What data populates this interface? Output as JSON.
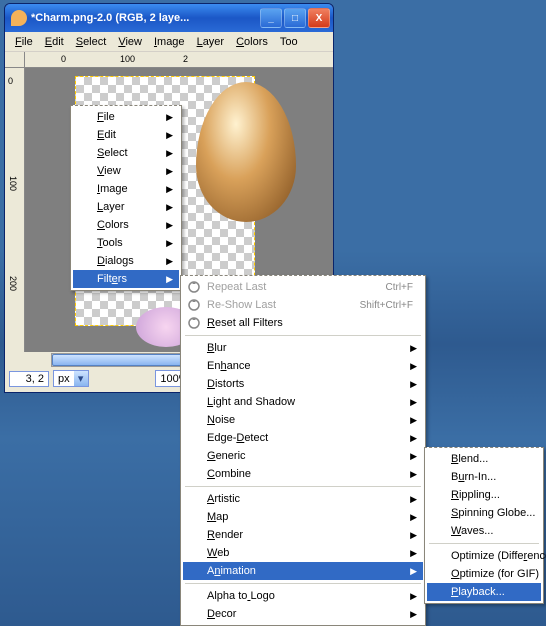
{
  "window": {
    "title": "*Charm.png-2.0 (RGB, 2 laye..."
  },
  "menubar": [
    "File",
    "Edit",
    "Select",
    "View",
    "Image",
    "Layer",
    "Colors",
    "Too"
  ],
  "ruler": {
    "h": [
      "0",
      "100",
      "2"
    ],
    "v": [
      "0",
      "100",
      "200"
    ]
  },
  "status": {
    "coord": "3, 2",
    "unit": "px",
    "zoom": "100%"
  },
  "ctx1": [
    {
      "label": "File",
      "u": 0,
      "sub": true
    },
    {
      "label": "Edit",
      "u": 0,
      "sub": true
    },
    {
      "label": "Select",
      "u": 0,
      "sub": true
    },
    {
      "label": "View",
      "u": 0,
      "sub": true
    },
    {
      "label": "Image",
      "u": 0,
      "sub": true
    },
    {
      "label": "Layer",
      "u": 0,
      "sub": true
    },
    {
      "label": "Colors",
      "u": 0,
      "sub": true
    },
    {
      "label": "Tools",
      "u": 0,
      "sub": true
    },
    {
      "label": "Dialogs",
      "u": 0,
      "sub": true
    },
    {
      "label": "Filters",
      "u": 4,
      "sub": true,
      "hl": true
    }
  ],
  "ctx2": [
    {
      "label": "Repeat Last",
      "sc": "Ctrl+F",
      "disabled": true,
      "icon": "repeat"
    },
    {
      "label": "Re-Show Last",
      "sc": "Shift+Ctrl+F",
      "disabled": true,
      "icon": "reshow"
    },
    {
      "label": "Reset all Filters",
      "u": 0,
      "icon": "reset"
    },
    {
      "sep": true
    },
    {
      "label": "Blur",
      "u": 0,
      "sub": true
    },
    {
      "label": "Enhance",
      "u": 2,
      "sub": true
    },
    {
      "label": "Distorts",
      "u": 0,
      "sub": true
    },
    {
      "label": "Light and Shadow",
      "u": 0,
      "sub": true
    },
    {
      "label": "Noise",
      "u": 0,
      "sub": true
    },
    {
      "label": "Edge-Detect",
      "u": 5,
      "sub": true
    },
    {
      "label": "Generic",
      "u": 0,
      "sub": true
    },
    {
      "label": "Combine",
      "u": 0,
      "sub": true
    },
    {
      "sep": true
    },
    {
      "label": "Artistic",
      "u": 0,
      "sub": true
    },
    {
      "label": "Map",
      "u": 0,
      "sub": true
    },
    {
      "label": "Render",
      "u": 0,
      "sub": true
    },
    {
      "label": "Web",
      "u": 0,
      "sub": true
    },
    {
      "label": "Animation",
      "u": 1,
      "sub": true,
      "hl": true
    },
    {
      "sep": true
    },
    {
      "label": "Alpha to Logo",
      "u": 8,
      "sub": true
    },
    {
      "label": "Decor",
      "u": 0,
      "sub": true
    }
  ],
  "ctx3": [
    {
      "label": "Blend...",
      "u": 0
    },
    {
      "label": "Burn-In...",
      "u": 1
    },
    {
      "label": "Rippling...",
      "u": 0
    },
    {
      "label": "Spinning Globe...",
      "u": 0
    },
    {
      "label": "Waves...",
      "u": 0
    },
    {
      "sep": true
    },
    {
      "label": "Optimize (Difference)",
      "u": 15
    },
    {
      "label": "Optimize (for GIF)",
      "u": 0
    },
    {
      "label": "Playback...",
      "u": 0,
      "hl": true
    }
  ]
}
